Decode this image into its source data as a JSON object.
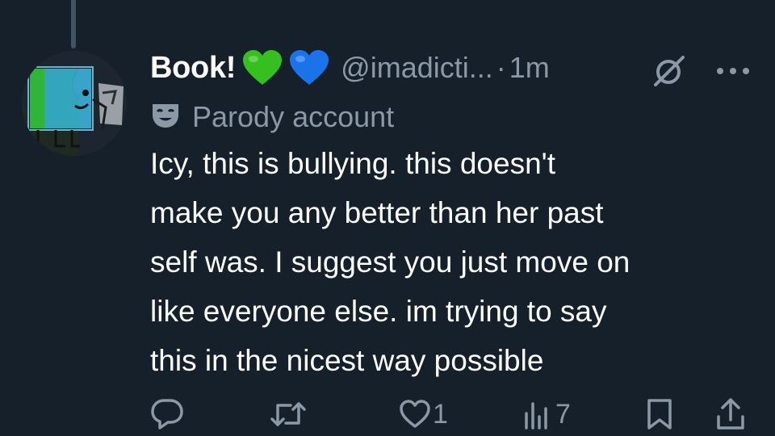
{
  "tweet": {
    "author_name": "Book!",
    "badges": [
      "green-heart-emoji",
      "blue-heart-emoji"
    ],
    "handle": "@imadicti...",
    "separator": "·",
    "time": "1m",
    "label_text": "Parody account",
    "body_lines": [
      "Icy, this is bullying. this doesn't",
      "make you any better than her past",
      "self was. I suggest you just move on",
      "like everyone else. im trying to say",
      "this in the nicest way possible"
    ]
  },
  "actions": {
    "reply_count": "",
    "retweet_count": "",
    "like_count": "1",
    "views_count": "7"
  },
  "icons": {
    "more": "more-icon",
    "grok": "grok-icon",
    "parody": "theater-mask-icon",
    "reply": "reply-icon",
    "retweet": "retweet-icon",
    "like": "heart-icon",
    "views": "analytics-icon",
    "bookmark": "bookmark-icon",
    "share": "share-icon"
  },
  "colors": {
    "background": "#15202b",
    "primary_text": "#ffffff",
    "secondary_text": "#8b98a5",
    "thread_line": "#425364",
    "green_heart": "#35c01f",
    "blue_heart": "#1a73e8"
  }
}
